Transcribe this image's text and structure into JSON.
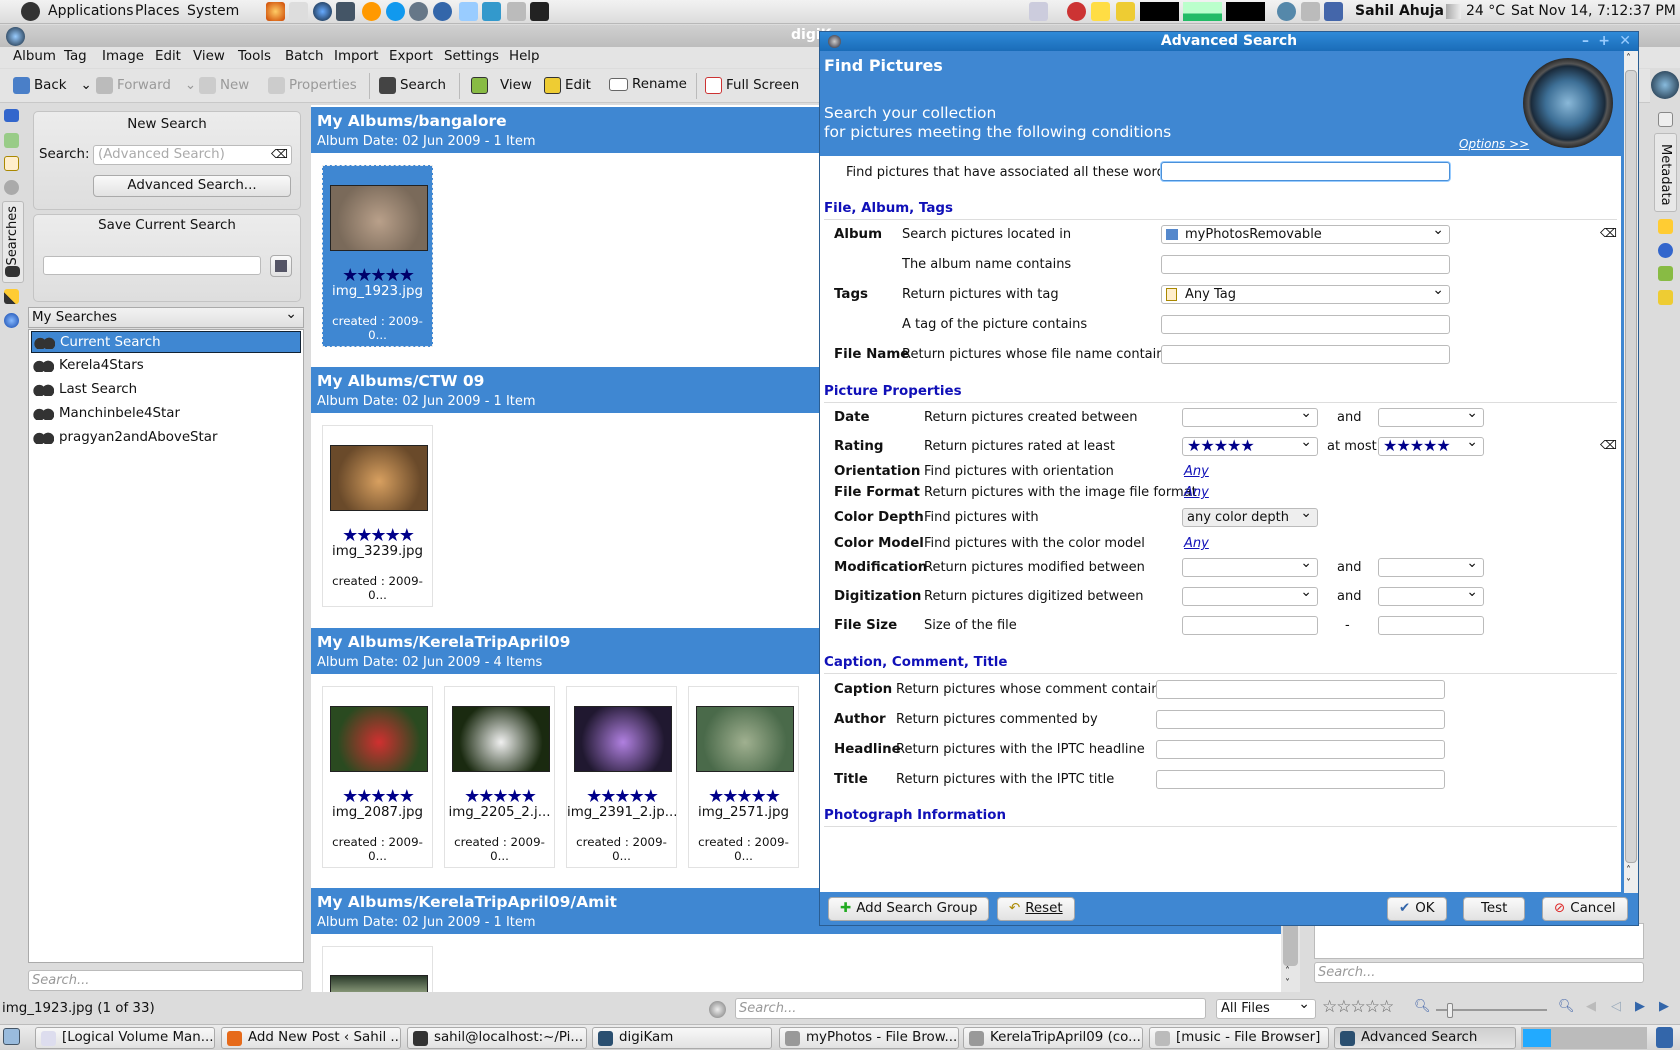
{
  "top_panel": {
    "menus": [
      "Applications",
      "Places",
      "System"
    ],
    "user": "Sahil Ahuja",
    "temperature": "24 °C",
    "clock": "Sat Nov 14,  7:12:37 PM"
  },
  "window": {
    "title": "digiKam"
  },
  "menubar": [
    "Album",
    "Tag",
    "Image",
    "Edit",
    "View",
    "Tools",
    "Batch",
    "Import",
    "Export",
    "Settings",
    "Help"
  ],
  "toolbar": {
    "back": "Back",
    "forward": "Forward",
    "new": "New",
    "properties": "Properties",
    "search": "Search",
    "view": "View",
    "edit": "Edit",
    "rename": "Rename",
    "fullscreen": "Full Screen"
  },
  "left_tabs": {
    "searches": "Searches"
  },
  "new_search": {
    "title": "New Search",
    "search_label": "Search:",
    "search_placeholder": "(Advanced Search)",
    "advanced_button": "Advanced Search..."
  },
  "save_search": {
    "title": "Save Current Search",
    "value": ""
  },
  "my_searches": {
    "title": "My Searches",
    "items": [
      {
        "label": "Current Search",
        "selected": true
      },
      {
        "label": "Kerela4Stars"
      },
      {
        "label": "Last Search"
      },
      {
        "label": "Manchinbele4Star"
      },
      {
        "label": "pragyan2andAboveStar"
      }
    ],
    "filter_placeholder": "Search..."
  },
  "albums": [
    {
      "title": "My Albums/bangalore",
      "date": "Album Date: 02 Jun 2009 - 1 Item",
      "items": [
        {
          "name": "img_1923.jpg",
          "created": "created : 2009-0...",
          "rating": 5,
          "selected": true
        }
      ]
    },
    {
      "title": "My Albums/CTW 09",
      "date": "Album Date: 02 Jun 2009 - 1 Item",
      "items": [
        {
          "name": "img_3239.jpg",
          "created": "created : 2009-0...",
          "rating": 5
        }
      ]
    },
    {
      "title": "My Albums/KerelaTripApril09",
      "date": "Album Date: 02 Jun 2009 - 4 Items",
      "items": [
        {
          "name": "img_2087.jpg",
          "created": "created : 2009-0...",
          "rating": 5
        },
        {
          "name": "img_2205_2.j...",
          "created": "created : 2009-0...",
          "rating": 5
        },
        {
          "name": "img_2391_2.jp...",
          "created": "created : 2009-0...",
          "rating": 5
        },
        {
          "name": "img_2571.jpg",
          "created": "created : 2009-0...",
          "rating": 5
        }
      ]
    },
    {
      "title": "My Albums/KerelaTripApril09/Amit",
      "date": "Album Date: 02 Jun 2009 - 1 Item",
      "items": []
    }
  ],
  "right_panel": {
    "filter_placeholder": "Search...",
    "tab": "Metadata"
  },
  "dialog": {
    "title": "Advanced Search",
    "heading": "Find Pictures",
    "subtitle1": "Search your collection",
    "subtitle2": "for pictures meeting the following conditions",
    "options_link": "Options >>",
    "words_label": "Find pictures that have associated all these words:",
    "words_value": "",
    "sections": [
      {
        "title": "File, Album, Tags",
        "rows": [
          {
            "label": "Album",
            "desc": "Search pictures located in",
            "control": "combo",
            "value": "myPhotosRemovable",
            "icon": "album-icon",
            "removable": true
          },
          {
            "label": "",
            "desc": "The album name contains",
            "control": "text",
            "value": ""
          },
          {
            "label": "Tags",
            "desc": "Return pictures with tag",
            "control": "combo",
            "value": "Any Tag",
            "icon": "tag-icon"
          },
          {
            "label": "",
            "desc": "A tag of the picture contains",
            "control": "text",
            "value": ""
          },
          {
            "label": "File Name",
            "desc": "Return pictures whose file name contains",
            "control": "text",
            "value": ""
          }
        ]
      },
      {
        "title": "Picture Properties",
        "rows": [
          {
            "label": "Date",
            "desc": "Return pictures created between",
            "control": "range",
            "connector": "and"
          },
          {
            "label": "Rating",
            "desc": "Return pictures rated at least",
            "control": "rating",
            "min": 5,
            "max": 5,
            "connector": "at most",
            "removable": true
          },
          {
            "label": "Orientation",
            "desc": "Find pictures with orientation",
            "control": "link",
            "value": "Any"
          },
          {
            "label": "File Format",
            "desc": "Return pictures with the image file format",
            "control": "link",
            "value": "Any"
          },
          {
            "label": "Color Depth",
            "desc": "Find pictures with",
            "control": "select",
            "value": "any color depth"
          },
          {
            "label": "Color Model",
            "desc": "Find pictures with the color model",
            "control": "link",
            "value": "Any"
          },
          {
            "label": "Modification",
            "desc": "Return pictures modified between",
            "control": "range",
            "connector": "and"
          },
          {
            "label": "Digitization",
            "desc": "Return pictures digitized between",
            "control": "range",
            "connector": "and"
          },
          {
            "label": "File Size",
            "desc": "Size of the file",
            "control": "spin",
            "connector": "-"
          }
        ]
      },
      {
        "title": "Caption, Comment, Title",
        "rows": [
          {
            "label": "Caption",
            "desc": "Return pictures whose comment contains",
            "control": "text",
            "value": ""
          },
          {
            "label": "Author",
            "desc": "Return pictures commented by",
            "control": "text",
            "value": ""
          },
          {
            "label": "Headline",
            "desc": "Return pictures with the IPTC headline",
            "control": "text",
            "value": ""
          },
          {
            "label": "Title",
            "desc": "Return pictures with the IPTC title",
            "control": "text",
            "value": ""
          }
        ]
      },
      {
        "title": "Photograph Information",
        "rows": []
      }
    ],
    "buttons": {
      "add_group": "Add Search Group",
      "reset": "Reset",
      "ok": "OK",
      "test": "Test",
      "cancel": "Cancel"
    }
  },
  "statusbar": {
    "item": "img_1923.jpg (1 of 33)",
    "search_placeholder": "Search...",
    "filter": "All Files",
    "rating_filter": 0
  },
  "taskbar": [
    {
      "label": "[Logical Volume Man...",
      "color": "#dde"
    },
    {
      "label": "Add New Post ‹ Sahil ...",
      "color": "#e66a1a"
    },
    {
      "label": "sahil@localhost:~/Pi...",
      "color": "#333"
    },
    {
      "label": "digiKam",
      "color": "#2a4f70"
    },
    {
      "label": "myPhotos - File Brow...",
      "color": "#999"
    },
    {
      "label": "KerelaTripApril09 (co...",
      "color": "#999"
    },
    {
      "label": "[music - File Browser]",
      "color": "#bbb"
    },
    {
      "label": "Advanced Search",
      "color": "#2a4f70",
      "active": true
    }
  ],
  "colors": {
    "accent": "#3f87d2",
    "section": "#1010b8",
    "stars": "#00008a"
  }
}
